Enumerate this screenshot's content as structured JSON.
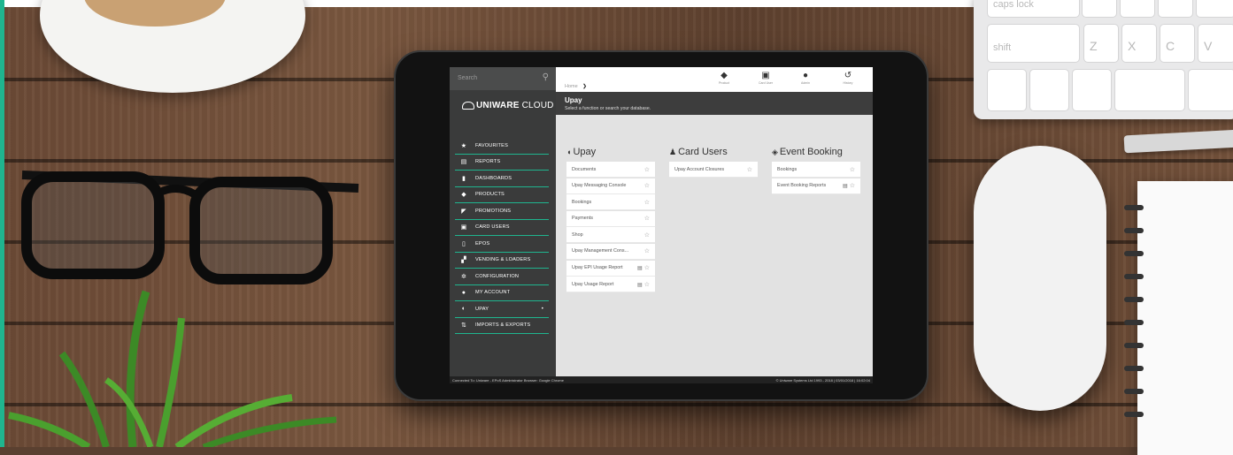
{
  "search": {
    "placeholder": "Search"
  },
  "logo": {
    "brand": "UNIWARE",
    "suffix": " CLOUD"
  },
  "sidebar": {
    "items": [
      {
        "label": "FAVOURITES",
        "icon": "star-icon",
        "glyph": "★"
      },
      {
        "label": "REPORTS",
        "icon": "document-icon",
        "glyph": "▤"
      },
      {
        "label": "DASHBOARDS",
        "icon": "bar-chart-icon",
        "glyph": "▮"
      },
      {
        "label": "PRODUCTS",
        "icon": "box-icon",
        "glyph": "◆"
      },
      {
        "label": "PROMOTIONS",
        "icon": "tag-icon",
        "glyph": "◤"
      },
      {
        "label": "CARD USERS",
        "icon": "id-card-icon",
        "glyph": "▣"
      },
      {
        "label": "EPOS",
        "icon": "till-icon",
        "glyph": "▯"
      },
      {
        "label": "VENDING & LOADERS",
        "icon": "vending-icon",
        "glyph": "▞"
      },
      {
        "label": "CONFIGURATION",
        "icon": "gear-icon",
        "glyph": "✲"
      },
      {
        "label": "MY ACCOUNT",
        "icon": "user-icon",
        "glyph": "●"
      },
      {
        "label": "UPAY",
        "icon": "shield-icon",
        "glyph": "◐",
        "marker": "•"
      },
      {
        "label": "IMPORTS & EXPORTS",
        "icon": "import-export-icon",
        "glyph": "⇅"
      }
    ]
  },
  "header": {
    "breadcrumb": "Home",
    "breadcrumb_sep": "❯",
    "title": "Upay",
    "subtitle": "Select a function or search your database.",
    "toolbar": [
      {
        "label": "Product",
        "icon": "box-icon",
        "glyph": "◆"
      },
      {
        "label": "Card User",
        "icon": "id-card-icon",
        "glyph": "▣"
      },
      {
        "label": "Admin",
        "icon": "user-icon",
        "glyph": "●"
      },
      {
        "label": "History",
        "icon": "history-icon",
        "glyph": "↺"
      }
    ]
  },
  "columns": [
    {
      "heading": "Upay",
      "icon": "shield-icon",
      "glyph": "◖",
      "items": [
        {
          "label": "Documents",
          "report": false
        },
        {
          "label": "Upay Messaging Console",
          "report": false
        },
        {
          "label": "Bookings",
          "report": false
        },
        {
          "label": "Payments",
          "report": false
        },
        {
          "label": "Shop",
          "report": false
        },
        {
          "label": "Upay Management Cons...",
          "report": false
        },
        {
          "label": "Upay EPI Usage Report",
          "report": true
        },
        {
          "label": "Upay Usage Report",
          "report": true
        }
      ]
    },
    {
      "heading": "Card Users",
      "icon": "user-icon",
      "glyph": "♟",
      "items": [
        {
          "label": "Upay Account Closures",
          "report": false
        }
      ]
    },
    {
      "heading": "Event Booking",
      "icon": "tag-icon",
      "glyph": "◈",
      "items": [
        {
          "label": "Bookings",
          "report": false
        },
        {
          "label": "Event Booking Reports",
          "report": true
        }
      ]
    }
  ],
  "footer": {
    "left": "Connected To: Uniware - EPoS Administrator   Browser: Google Chrome",
    "right": "© Uniware Systems Ltd 1993 - 2018 | 03/01/2018 | 16:02:04"
  },
  "keyboard": {
    "keys": [
      "caps lock",
      "shift",
      "Z",
      "X",
      "C",
      "V"
    ]
  },
  "colors": {
    "accent": "#1fb58f",
    "sidebar": "#3a3b3b",
    "titlebar": "#3d3d3d"
  }
}
